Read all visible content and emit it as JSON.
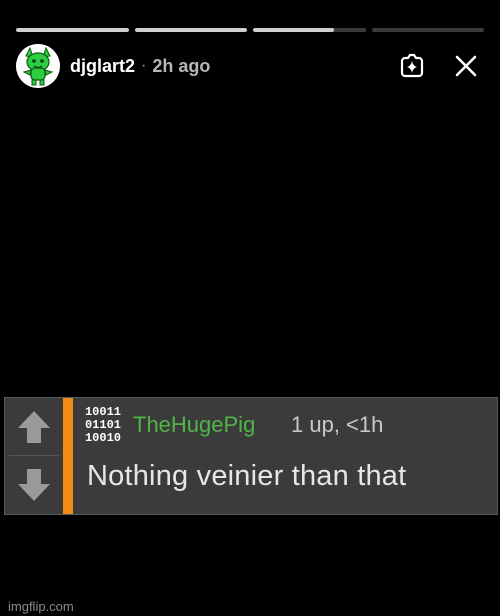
{
  "story": {
    "progress": [
      1,
      1,
      0.72,
      0
    ],
    "username": "djglart2",
    "separator": "·",
    "time_ago": "2h ago"
  },
  "icons": {
    "avatar": "green-creature-avatar",
    "sparkle": "sparkle-camera-icon",
    "close": "close-icon",
    "upvote": "upvote-arrow-icon",
    "downvote": "downvote-arrow-icon"
  },
  "comment": {
    "badge_rows": [
      "10011",
      "01101",
      "10010"
    ],
    "author": "TheHugePig",
    "meta": "1 up, <1h",
    "text": "Nothing veinier than that",
    "accent_color": "#f28a14",
    "author_color": "#50b548"
  },
  "watermark": "imgflip.com"
}
